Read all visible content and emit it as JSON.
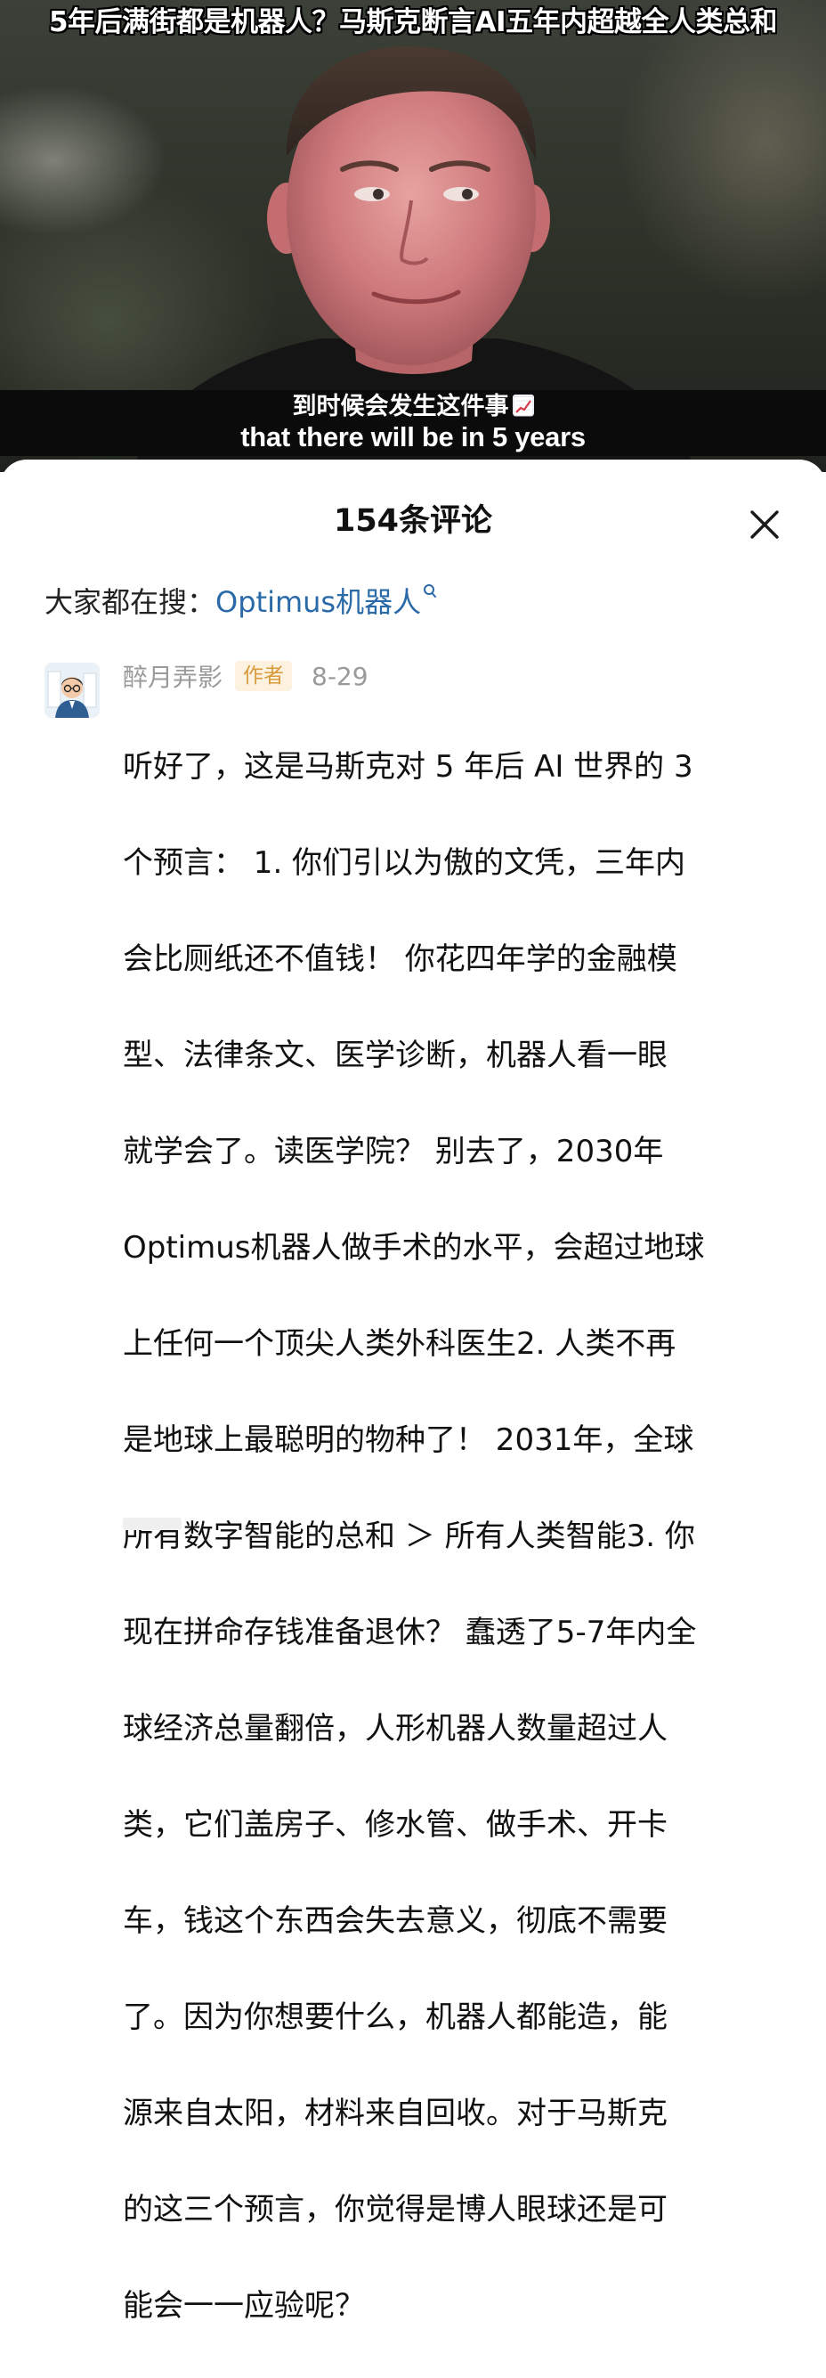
{
  "video": {
    "title_overlay": "5年后满街都是机器人？马斯克断言AI五年内超越全人类总和",
    "subtitle_cn": "到时候会发生这件事",
    "subtitle_en": "that there will be in 5 years",
    "subtitle_emoji": "chart-increasing-icon"
  },
  "comments_panel": {
    "title": "154条评论",
    "close_icon": "close-icon",
    "search_hint_label": "大家都在搜：",
    "search_hint_term": "Optimus机器人",
    "search_hint_icon": "search-icon"
  },
  "comment": {
    "author": "醉月弄影",
    "badge": "作者",
    "date": "8-29",
    "lines": [
      "听好了，这是马斯克对 5 年后 AI 世界的 3",
      "个预言： 1. 你们引以为傲的文凭，三年内",
      "会比厕纸还不值钱！ 你花四年学的金融模",
      "型、法律条文、医学诊断，机器人看一眼",
      "就学会了。读医学院？ 别去了，2030年",
      "Optimus机器人做手术的水平，会超过地球",
      "上任何一个顶尖人类外科医生2. 人类不再",
      "是地球上最聪明的物种了！ 2031年，全球",
      "所有数字智能的总和 ＞ 所有人类智能3. 你",
      "现在拼命存钱准备退休？ 蠢透了5-7年内全",
      "球经济总量翻倍，人形机器人数量超过人",
      "类，它们盖房子、修水管、做手术、开卡",
      "车，钱这个东西会失去意义，彻底不需要",
      "了。因为你想要什么，机器人都能造，能",
      "源来自太阳，材料来自回收。对于马斯克",
      "的这三个预言，你觉得是博人眼球还是可",
      "能会一一应验呢？"
    ]
  },
  "colors": {
    "link": "#2a6aa8",
    "badge_bg": "#fdf1df",
    "badge_text": "#d99a3c",
    "meta_text": "#9a9a9a"
  }
}
